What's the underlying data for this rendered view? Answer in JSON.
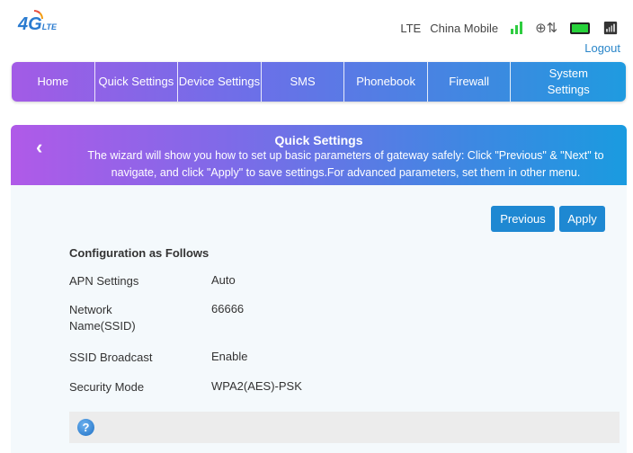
{
  "header": {
    "logo": "4G LTE",
    "network_type": "LTE",
    "carrier": "China Mobile",
    "logout": "Logout",
    "signal_bars": 3
  },
  "nav": {
    "items": [
      "Home",
      "Quick Settings",
      "Device Settings",
      "SMS",
      "Phonebook",
      "Firewall",
      "System Settings"
    ]
  },
  "wizard": {
    "title": "Quick Settings",
    "description": "The wizard will show you how to set up basic parameters of gateway safely: Click \"Previous\" & \"Next\" to navigate, and click \"Apply\" to save settings.For advanced parameters, set them in other menu.",
    "back": "‹"
  },
  "buttons": {
    "previous": "Previous",
    "apply": "Apply"
  },
  "config": {
    "heading": "Configuration as Follows",
    "rows": [
      {
        "label": "APN Settings",
        "value": "Auto"
      },
      {
        "label": "Network Name(SSID)",
        "value": "66666"
      },
      {
        "label": "SSID Broadcast",
        "value": "Enable"
      },
      {
        "label": "Security Mode",
        "value": "WPA2(AES)-PSK"
      }
    ]
  },
  "help": {
    "icon": "?"
  }
}
